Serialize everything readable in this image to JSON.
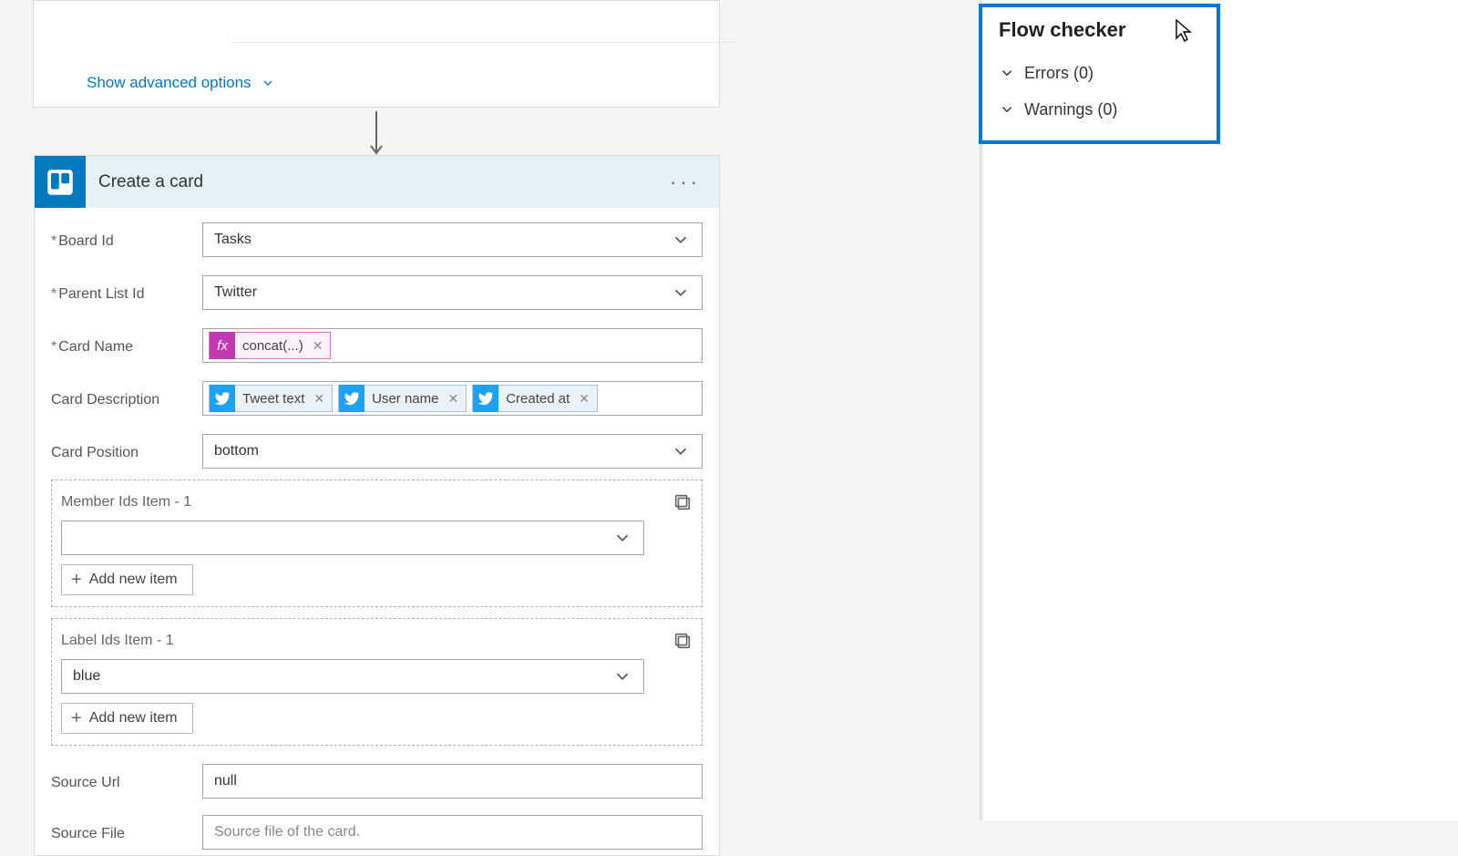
{
  "prev": {
    "advanced": "Show advanced options"
  },
  "action": {
    "title": "Create a card",
    "fields": {
      "board": {
        "label": "Board Id",
        "value": "Tasks"
      },
      "parent": {
        "label": "Parent List Id",
        "value": "Twitter"
      },
      "cardName": {
        "label": "Card Name",
        "fx": "concat(...)"
      },
      "desc": {
        "label": "Card Description",
        "tokens": [
          "Tweet text",
          "User name",
          "Created at"
        ]
      },
      "position": {
        "label": "Card Position",
        "value": "bottom"
      },
      "members": {
        "label": "Member Ids Item - 1",
        "add": "Add new item"
      },
      "labels": {
        "label": "Label Ids Item - 1",
        "value": "blue",
        "add": "Add new item"
      },
      "sourceUrl": {
        "label": "Source Url",
        "value": "null"
      },
      "sourceFile": {
        "label": "Source File",
        "placeholder": "Source file of the card."
      }
    }
  },
  "checker": {
    "title": "Flow checker",
    "errors": "Errors (0)",
    "warnings": "Warnings (0)"
  }
}
